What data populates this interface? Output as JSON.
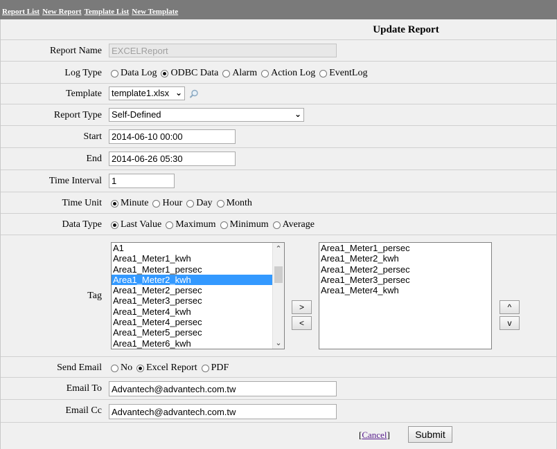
{
  "nav": {
    "links": [
      "Report List",
      "New Report",
      "Template List",
      "New Template"
    ]
  },
  "form": {
    "title": "Update Report",
    "report_name": {
      "label": "Report Name",
      "value": "EXCELReport"
    },
    "log_type": {
      "label": "Log Type",
      "options": [
        "Data Log",
        "ODBC Data",
        "Alarm",
        "Action Log",
        "EventLog"
      ],
      "selected": "ODBC Data"
    },
    "template": {
      "label": "Template",
      "value": "template1.xlsx"
    },
    "report_type": {
      "label": "Report Type",
      "value": "Self-Defined"
    },
    "start": {
      "label": "Start",
      "value": "2014-06-10 00:00"
    },
    "end": {
      "label": "End",
      "value": "2014-06-26 05:30"
    },
    "time_interval": {
      "label": "Time Interval",
      "value": "1"
    },
    "time_unit": {
      "label": "Time Unit",
      "options": [
        "Minute",
        "Hour",
        "Day",
        "Month"
      ],
      "selected": "Minute"
    },
    "data_type": {
      "label": "Data Type",
      "options": [
        "Last Value",
        "Maximum",
        "Minimum",
        "Average"
      ],
      "selected": "Last Value"
    },
    "tag": {
      "label": "Tag",
      "available": [
        "A1",
        "Area1_Meter1_kwh",
        "Area1_Meter1_persec",
        "Area1_Meter2_kwh",
        "Area1_Meter2_persec",
        "Area1_Meter3_persec",
        "Area1_Meter4_kwh",
        "Area1_Meter4_persec",
        "Area1_Meter5_persec",
        "Area1_Meter6_kwh"
      ],
      "available_selected": "Area1_Meter2_kwh",
      "selected_tags": [
        "Area1_Meter1_persec",
        "Area1_Meter2_kwh",
        "Area1_Meter2_persec",
        "Area1_Meter3_persec",
        "Area1_Meter4_kwh"
      ],
      "add_label": ">",
      "remove_label": "<",
      "move_up_label": "^",
      "move_down_label": "v"
    },
    "send_email": {
      "label": "Send Email",
      "options": [
        "No",
        "Excel Report",
        "PDF"
      ],
      "selected": "Excel Report"
    },
    "email_to": {
      "label": "Email To",
      "value": "Advantech@advantech.com.tw"
    },
    "email_cc": {
      "label": "Email Cc",
      "value": "Advantech@advantech.com.tw"
    },
    "cancel_label": "Cancel",
    "submit_label": "Submit"
  }
}
